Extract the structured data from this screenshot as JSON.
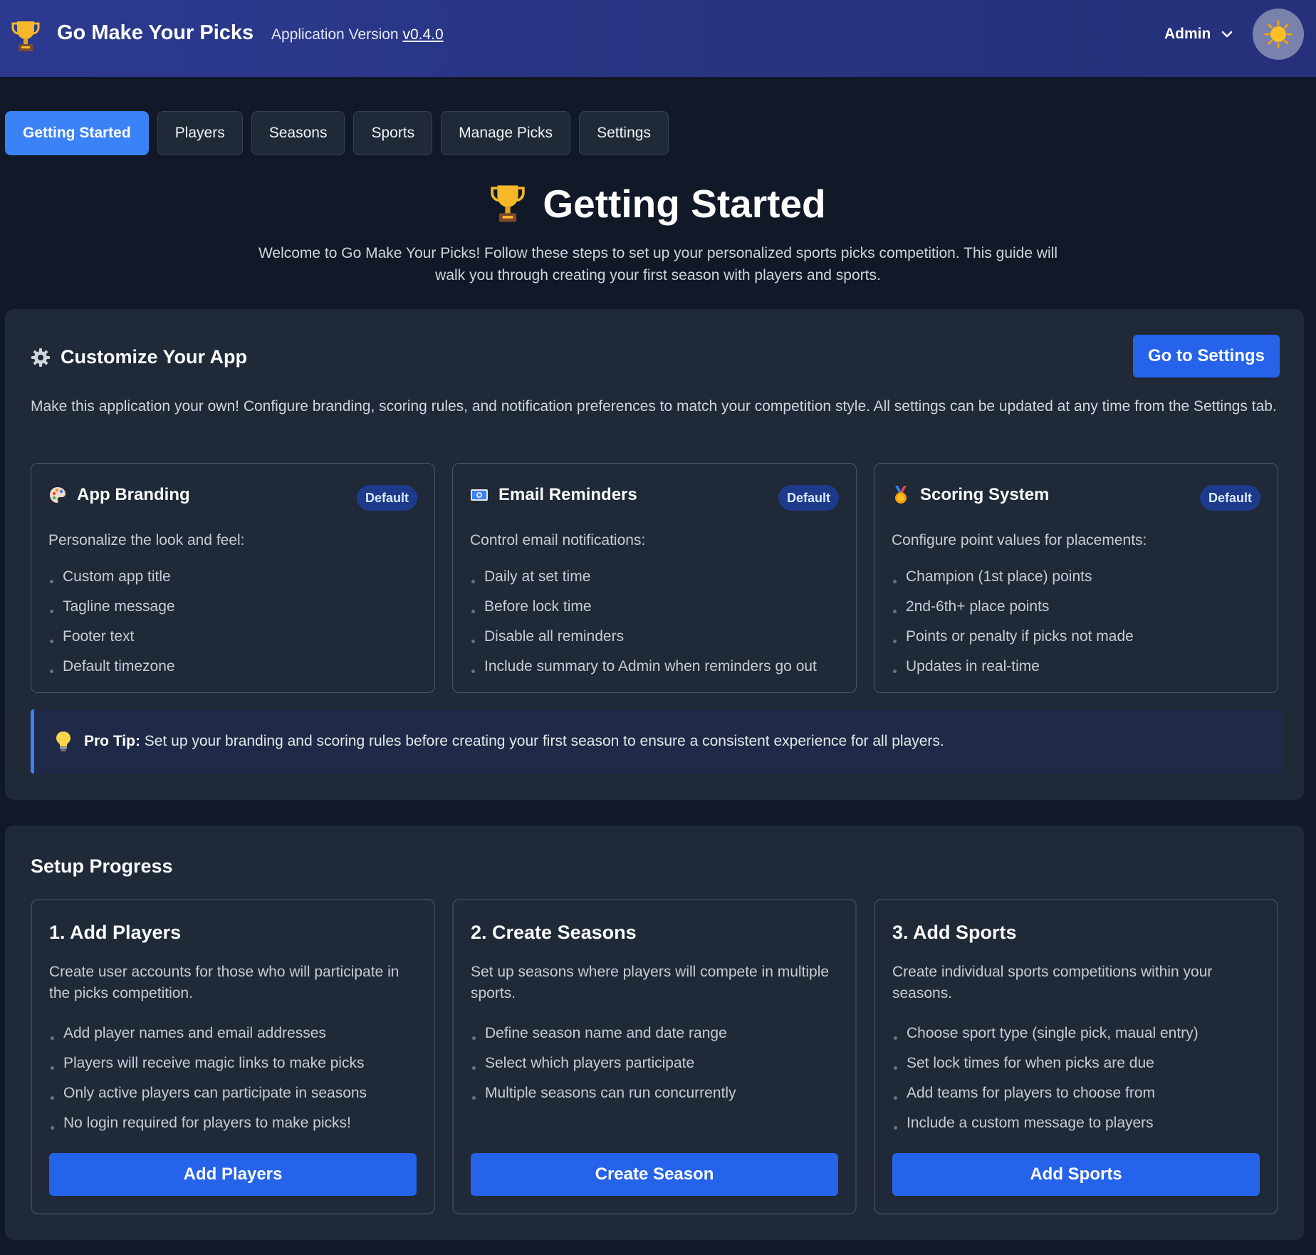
{
  "header": {
    "app_title": "Go Make Your Picks",
    "version_label": "Application Version",
    "version_link": "v0.4.0",
    "user_menu_label": "Admin"
  },
  "tabs": [
    {
      "label": "Getting Started",
      "active": true
    },
    {
      "label": "Players"
    },
    {
      "label": "Seasons"
    },
    {
      "label": "Sports"
    },
    {
      "label": "Manage Picks"
    },
    {
      "label": "Settings"
    }
  ],
  "page": {
    "title": "Getting Started",
    "intro": "Welcome to Go Make Your Picks! Follow these steps to set up your personalized sports picks competition. This guide will walk you through creating your first season with players and sports."
  },
  "customize": {
    "title": "Customize Your App",
    "button": "Go to Settings",
    "description": "Make this application your own! Configure branding, scoring rules, and notification preferences to match your competition style. All settings can be updated at any time from the Settings tab.",
    "cards": [
      {
        "icon": "palette-icon",
        "title": "App Branding",
        "badge": "Default",
        "lead": "Personalize the look and feel:",
        "items": [
          "Custom app title",
          "Tagline message",
          "Footer text",
          "Default timezone"
        ]
      },
      {
        "icon": "email-icon",
        "title": "Email Reminders",
        "badge": "Default",
        "lead": "Control email notifications:",
        "items": [
          "Daily at set time",
          "Before lock time",
          "Disable all reminders",
          "Include summary to Admin when reminders go out"
        ]
      },
      {
        "icon": "medal-icon",
        "title": "Scoring System",
        "badge": "Default",
        "lead": "Configure point values for placements:",
        "items": [
          "Champion (1st place) points",
          "2nd-6th+ place points",
          "Points or penalty if picks not made",
          "Updates in real-time"
        ]
      }
    ],
    "pro_tip": {
      "label": "Pro Tip:",
      "text": "Set up your branding and scoring rules before creating your first season to ensure a consistent experience for all players."
    }
  },
  "progress": {
    "title": "Setup Progress",
    "steps": [
      {
        "title": "1. Add Players",
        "description": "Create user accounts for those who will participate in the picks competition.",
        "items": [
          "Add player names and email addresses",
          "Players will receive magic links to make picks",
          "Only active players can participate in seasons",
          "No login required for players to make picks!"
        ],
        "button": "Add Players"
      },
      {
        "title": "2. Create Seasons",
        "description": "Set up seasons where players will compete in multiple sports.",
        "items": [
          "Define season name and date range",
          "Select which players participate",
          "Multiple seasons can run concurrently"
        ],
        "button": "Create Season"
      },
      {
        "title": "3. Add Sports",
        "description": "Create individual sports competitions within your seasons.",
        "items": [
          "Choose sport type (single pick, maual entry)",
          "Set lock times for when picks are due",
          "Add teams for players to choose from",
          "Include a custom message to players"
        ],
        "button": "Add Sports"
      }
    ]
  },
  "colors": {
    "background": "#111827",
    "card": "#1f2937",
    "accent": "#2563eb",
    "header": "#283583"
  }
}
